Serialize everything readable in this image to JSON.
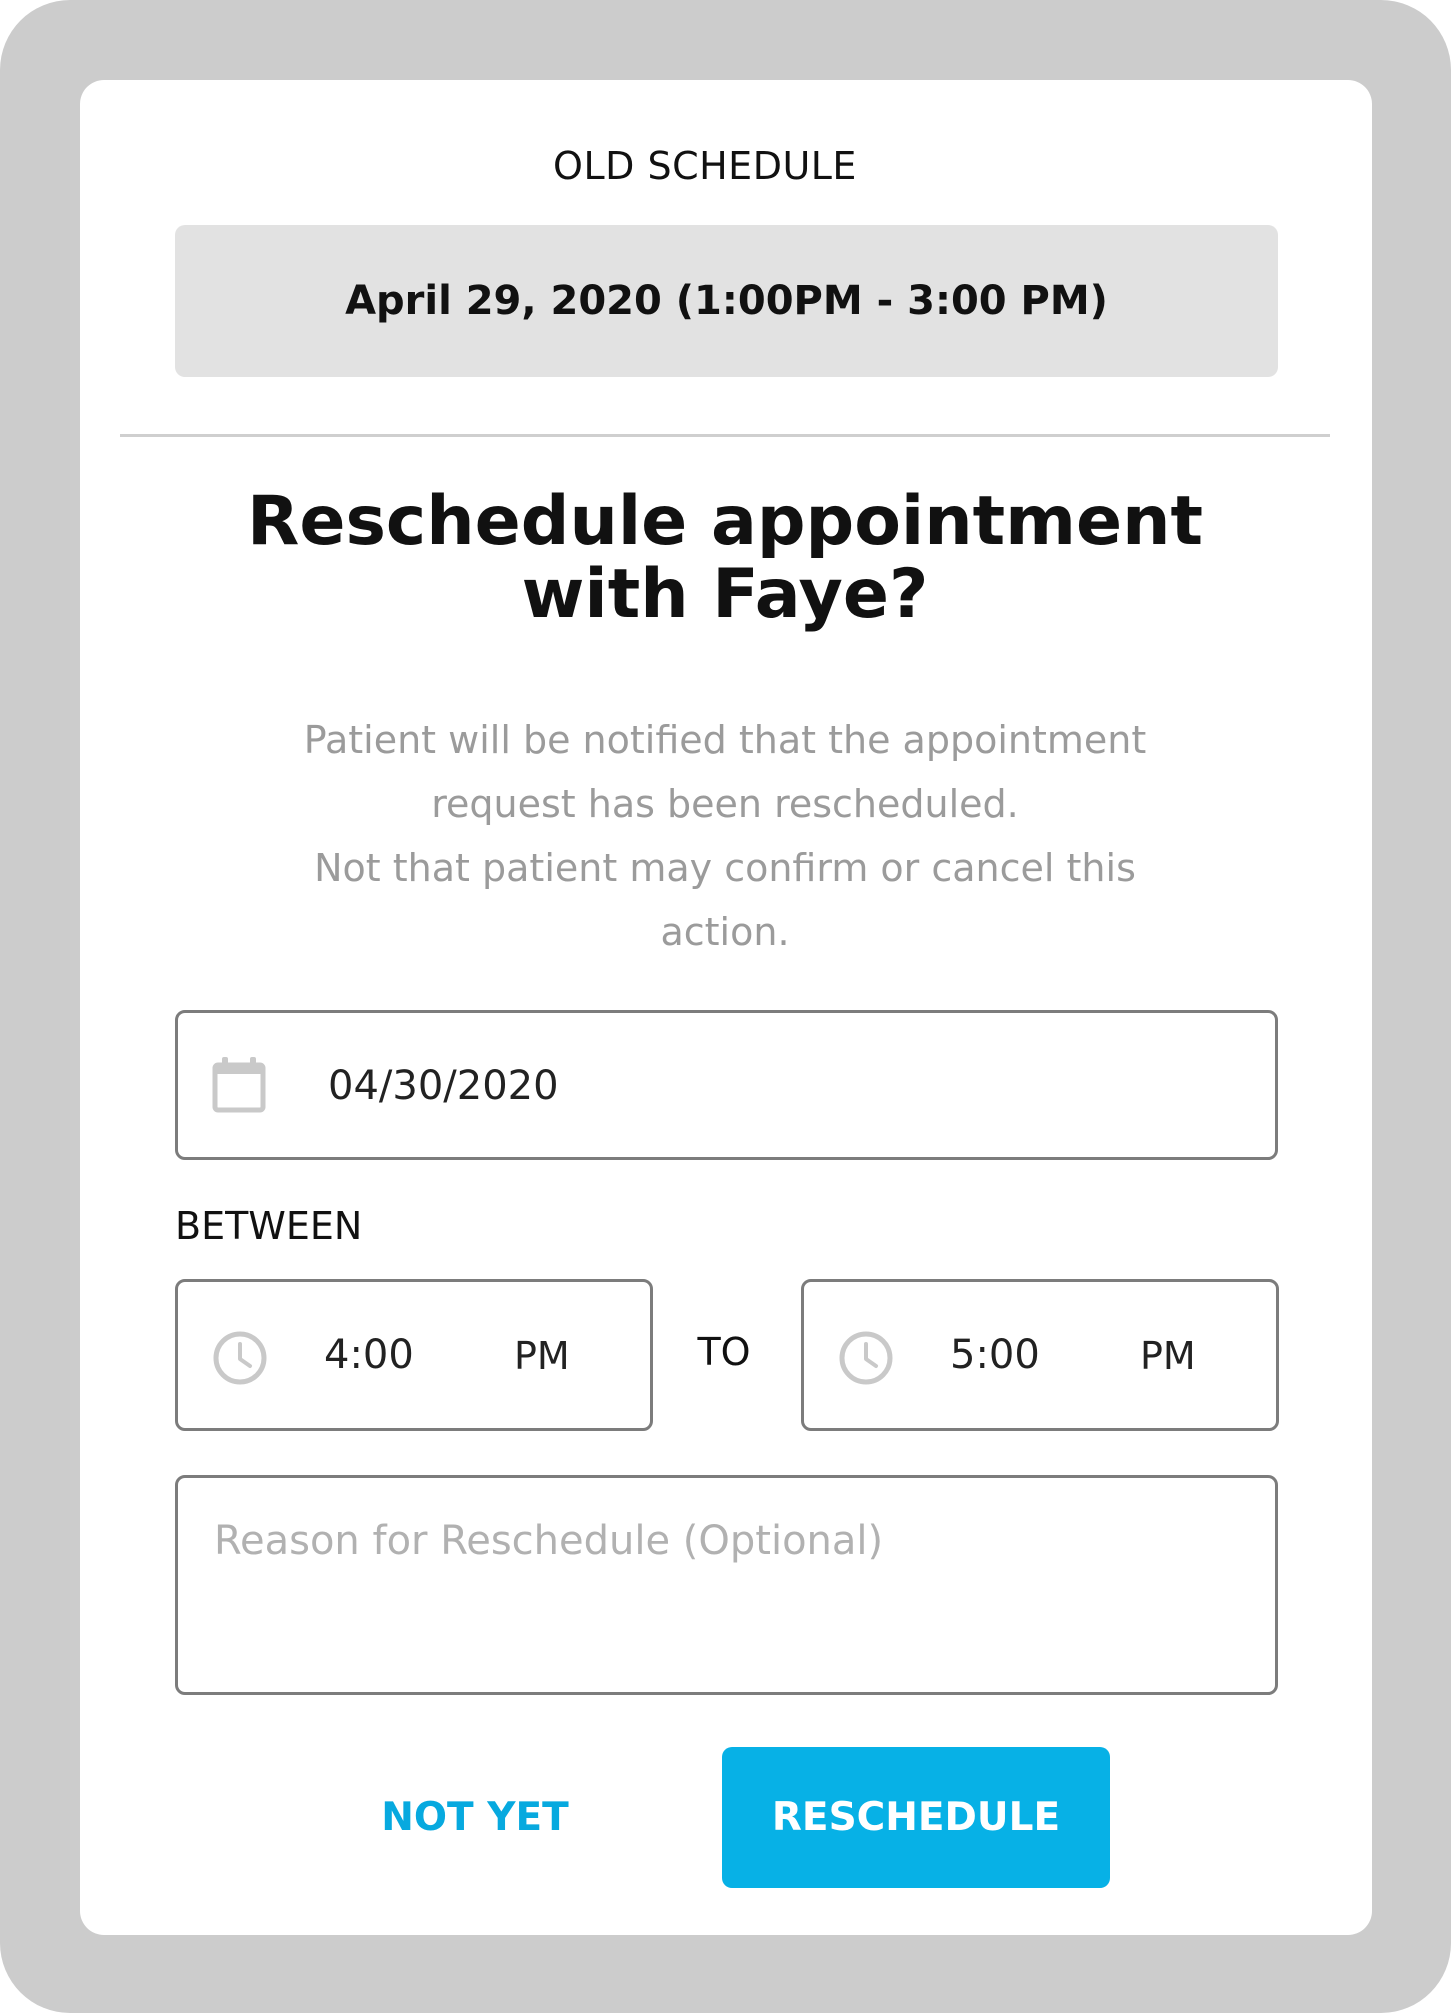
{
  "old_schedule": {
    "label": "OLD SCHEDULE",
    "value": "April 29, 2020 (1:00PM - 3:00 PM)"
  },
  "dialog": {
    "title_line1": "Reschedule appointment",
    "title_line2": "with Faye?",
    "description_line1": "Patient will be notified that the appointment",
    "description_line2": "request has been rescheduled.",
    "description_line3": "Not that patient may confirm or cancel this",
    "description_line4": "action."
  },
  "date_field": {
    "icon": "calendar-icon",
    "value": "04/30/2020"
  },
  "time_range": {
    "between_label": "BETWEEN",
    "to_label": "TO",
    "from": {
      "icon": "clock-icon",
      "time": "4:00",
      "period": "PM"
    },
    "to": {
      "icon": "clock-icon",
      "time": "5:00",
      "period": "PM"
    }
  },
  "reason_field": {
    "placeholder": "Reason for Reschedule (Optional)",
    "value": ""
  },
  "actions": {
    "not_yet_label": "NOT YET",
    "reschedule_label": "RESCHEDULE"
  },
  "colors": {
    "accent": "#07b1e6",
    "backdrop": "#cccccc",
    "old_schedule_bg": "#e2e2e2",
    "muted_text": "#9b9b9b",
    "field_border": "#7c7c7c"
  }
}
